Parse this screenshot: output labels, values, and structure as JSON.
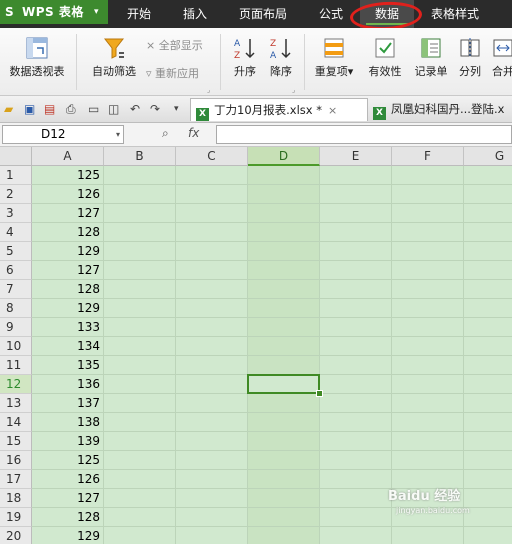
{
  "app": {
    "logo": "S",
    "name": "WPS 表格",
    "caret": "▾"
  },
  "menu": [
    {
      "label": "开始",
      "active": false
    },
    {
      "label": "插入",
      "active": false
    },
    {
      "label": "页面布局",
      "active": false
    },
    {
      "label": "公式",
      "active": false
    },
    {
      "label": "数据",
      "active": true
    },
    {
      "label": "表格样式",
      "active": false
    }
  ],
  "ribbon": {
    "pivot": "数据透视表",
    "autofilter": "自动筛选",
    "show_all": "全部显示",
    "reapply": "重新应用",
    "sort_asc": "升序",
    "sort_desc": "降序",
    "duplicates": "重复项",
    "dup_caret": "▾",
    "validation": "有效性",
    "form": "记录单",
    "split": "分列",
    "merge": "合并"
  },
  "tabs": [
    {
      "label": "丁力10月报表.xlsx *",
      "active": true,
      "close": "×"
    },
    {
      "label": "凤凰妇科国丹...登陆.x",
      "active": false
    }
  ],
  "formula_bar": {
    "cell_ref": "D12",
    "dropdown": "▾",
    "zoom_icon": "⌕",
    "fx": "fx",
    "value": ""
  },
  "columns": [
    "A",
    "B",
    "C",
    "D",
    "E",
    "F",
    "G"
  ],
  "selected_column": "D",
  "rows": [
    {
      "num": "1",
      "a": "125"
    },
    {
      "num": "2",
      "a": "126"
    },
    {
      "num": "3",
      "a": "127"
    },
    {
      "num": "4",
      "a": "128"
    },
    {
      "num": "5",
      "a": "129"
    },
    {
      "num": "6",
      "a": "127"
    },
    {
      "num": "7",
      "a": "128"
    },
    {
      "num": "8",
      "a": "129"
    },
    {
      "num": "9",
      "a": "133"
    },
    {
      "num": "10",
      "a": "134"
    },
    {
      "num": "11",
      "a": "135"
    },
    {
      "num": "12",
      "a": "136"
    },
    {
      "num": "13",
      "a": "137"
    },
    {
      "num": "14",
      "a": "138"
    },
    {
      "num": "15",
      "a": "139"
    },
    {
      "num": "16",
      "a": "125"
    },
    {
      "num": "17",
      "a": "126"
    },
    {
      "num": "18",
      "a": "127"
    },
    {
      "num": "19",
      "a": "128"
    },
    {
      "num": "20",
      "a": "129"
    }
  ],
  "selected_row": "12",
  "watermark": {
    "main": "Baidu 经验",
    "sub": "jingyan.baidu.com"
  },
  "colors": {
    "accent": "#3d8a2e",
    "sheet_bg": "#d1e9cf",
    "annotation": "#e0211c"
  }
}
